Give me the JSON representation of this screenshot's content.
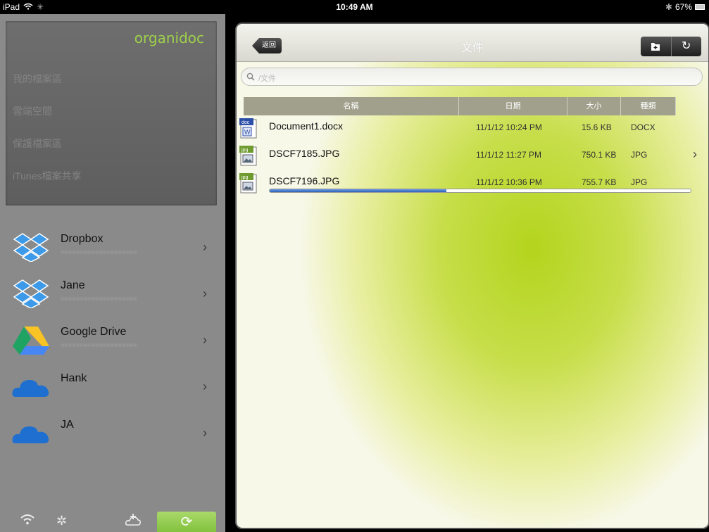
{
  "status_bar": {
    "device": "iPad",
    "time": "10:49 AM",
    "battery": "67%"
  },
  "sidebar": {
    "logo": "organidoc",
    "nav": [
      {
        "label": "我的檔案區"
      },
      {
        "label": "雲端空間"
      },
      {
        "label": "保護檔案區"
      },
      {
        "label": "iTunes檔案共享"
      }
    ],
    "accounts": [
      {
        "name": "Dropbox",
        "icon": "dropbox-icon"
      },
      {
        "name": "Jane",
        "icon": "dropbox-icon"
      },
      {
        "name": "Google Drive",
        "icon": "google-drive-icon"
      },
      {
        "name": "Hank",
        "icon": "skydrive-icon"
      },
      {
        "name": "JA",
        "icon": "skydrive-icon"
      }
    ],
    "chevron": "›"
  },
  "main": {
    "back_label": "返回",
    "title": "文件",
    "search_placeholder": "/文件",
    "columns": [
      "名稱",
      "日期",
      "大小",
      "種類"
    ],
    "files": [
      {
        "name": "Document1.docx",
        "date": "11/1/12 10:24 PM",
        "size": "15.6 KB",
        "type": "DOCX",
        "badge": "doc",
        "icon": "word-document-icon"
      },
      {
        "name": "DSCF7185.JPG",
        "date": "11/1/12 11:27 PM",
        "size": "750.1 KB",
        "type": "JPG",
        "badge": "jpg",
        "icon": "image-file-icon"
      },
      {
        "name": "DSCF7196.JPG",
        "date": "11/1/12 10:36 PM",
        "size": "755.7 KB",
        "type": "JPG",
        "badge": "jpg",
        "icon": "image-file-icon",
        "upload_progress": 0.42
      }
    ]
  },
  "colors": {
    "accent_green": "#8cc63f",
    "header_gray": "#a0a08c",
    "progress_blue": "#2b5fb6"
  }
}
